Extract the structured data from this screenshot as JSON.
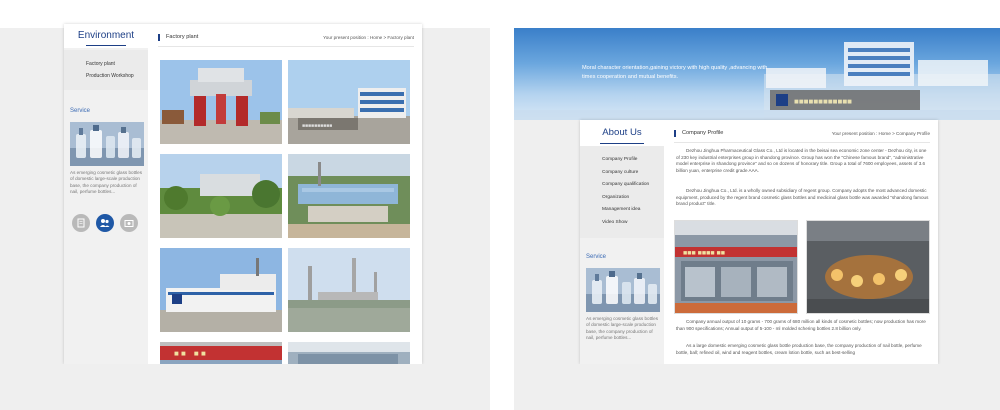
{
  "left_page": {
    "sidebar": {
      "title": "Environment",
      "nav": [
        "Factory plant",
        "Production Workshop"
      ],
      "service_title": "Service",
      "service_text": "As emerging cosmetic glass bottles of domestic large-scale production base, the company production of nail, perfume bottles...",
      "icons": [
        "document-icon",
        "user-group-icon",
        "camera-icon"
      ]
    },
    "main": {
      "heading": "Factory plant",
      "breadcrumb": "Your present position : Home > Factory plant",
      "photos": [
        "factory-gate",
        "office-building",
        "landscape-garden",
        "factory-aerial",
        "workshop-building",
        "chimney-skyline",
        "storefront-sign",
        "workshop-interior"
      ]
    }
  },
  "right_page": {
    "banner_text": "Moral character orientation,gaining victory with high quality ,advancing with times cooperation and mutual benefits.",
    "sidebar": {
      "title": "About Us",
      "nav": [
        "Company Profile",
        "Company culture",
        "Company qualification",
        "Organization",
        "Management idea",
        "Video Show"
      ],
      "service_title": "Service",
      "service_text": "As emerging cosmetic glass bottles of domestic large-scale production base, the company production of nail, perfume bottles..."
    },
    "main": {
      "heading": "Company Profile",
      "breadcrumb": "Your present position : Home > Company Profile",
      "para1": "Dezhou Jinghua Pharmaceutical Glass Co., Ltd is located in the beisai sea economic zone center - Dezhou city, is one of 230 key industrial enterprises group in shandong province. Group has won the \"Chinese famous brand\", \"administrative model enterprise in shandong province\" and so on dozens of honorary title. Group a total of 7600 employees, assets of 3.6 billion yuan, enterprise credit grade AAA.",
      "para2": "Dezhou Jinghua Co., Ltd. is a wholly owned subsidiary of regent group. Company adopts the most advanced domestic equipment, produced by the regent brand cosmetic glass bottles and medicinal glass bottle was awarded \"shandong famous brand product\" title.",
      "para3": "Company annual output of 10 grams - 700 grams of 680 million all kinds of cosmetic bottles; now production has more than 900 specifications; Annual output of 5-100 - ml molded schering bottles 2.8 billion only.",
      "para4": "As a large domestic emerging cosmetic glass bottle production base, the company production of nail bottle, perfume bottle, ball; refined oil, wind and reagent bottles, cream lotion bottle, such as best-selling",
      "photos": [
        "production-line",
        "glass-furnace"
      ]
    }
  },
  "colors": {
    "accent": "#1d3f86",
    "service_blue": "#3a6ab4",
    "icon_active": "#1f58a6",
    "icon_inactive": "#b9b9b9",
    "panel_bg": "#efefef"
  }
}
